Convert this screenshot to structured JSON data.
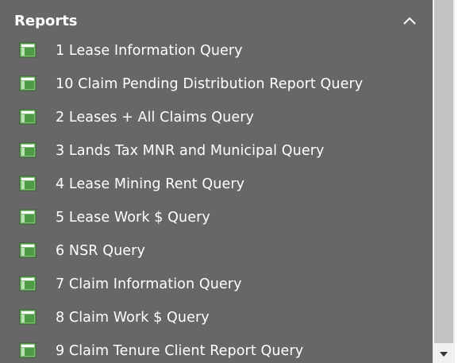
{
  "group": {
    "title": "Reports",
    "collapse_icon": "chevron-up-icon"
  },
  "items": [
    {
      "label": "1 Lease Information Query",
      "icon": "report-icon"
    },
    {
      "label": "10 Claim Pending Distribution Report Query",
      "icon": "report-icon"
    },
    {
      "label": "2 Leases + All Claims Query",
      "icon": "report-icon"
    },
    {
      "label": "3 Lands Tax MNR and Municipal Query",
      "icon": "report-icon"
    },
    {
      "label": "4 Lease Mining Rent Query",
      "icon": "report-icon"
    },
    {
      "label": "5 Lease Work $ Query",
      "icon": "report-icon"
    },
    {
      "label": "6 NSR Query",
      "icon": "report-icon"
    },
    {
      "label": "7 Claim Information Query",
      "icon": "report-icon"
    },
    {
      "label": "8 Claim Work $ Query",
      "icon": "report-icon"
    },
    {
      "label": "9 Claim Tenure Client Report Query",
      "icon": "report-icon"
    }
  ],
  "colors": {
    "pane_background": "#676767",
    "text": "#ffffff",
    "icon_green": "#4f9a46",
    "scrollbar_track": "#f0f0f0",
    "scrollbar_thumb": "#c2c2c2"
  }
}
